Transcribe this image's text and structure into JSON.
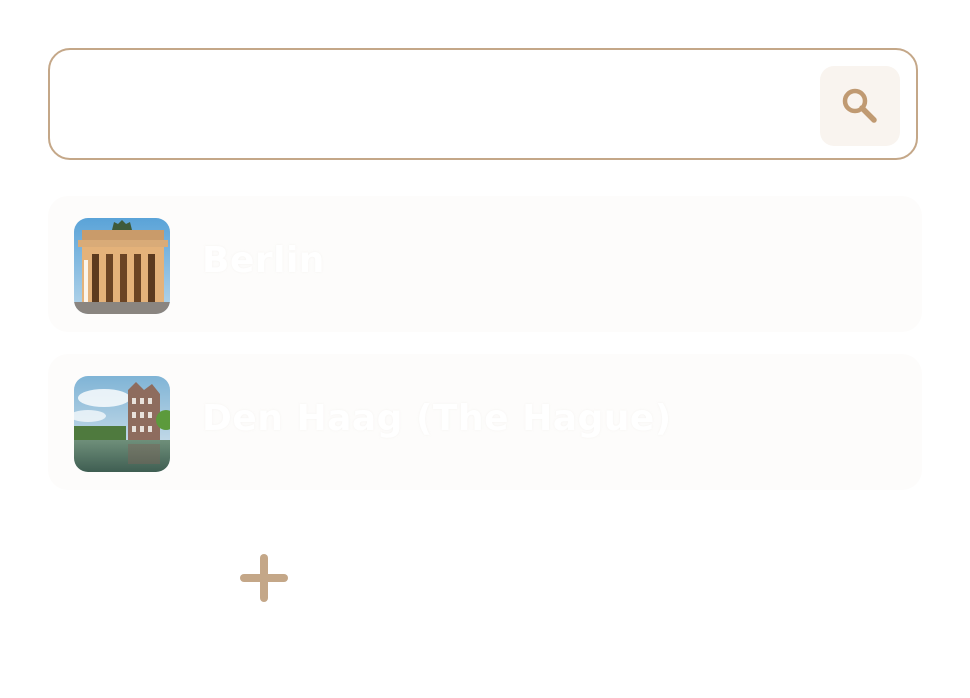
{
  "search": {
    "value": "",
    "placeholder": "",
    "icon": "search-icon"
  },
  "cities": [
    {
      "name": "Berlin",
      "thumbnail": "brandenburg-gate-photo"
    },
    {
      "name": "Den Haag (The Hague)",
      "thumbnail": "hague-binnenhof-photo"
    }
  ],
  "add_button": {
    "icon": "plus-icon"
  },
  "colors": {
    "accent": "#c4a788",
    "accent_icon": "#c09a72",
    "search_button_bg": "#f9f4ef",
    "card_bg": "#fdfcfb"
  }
}
